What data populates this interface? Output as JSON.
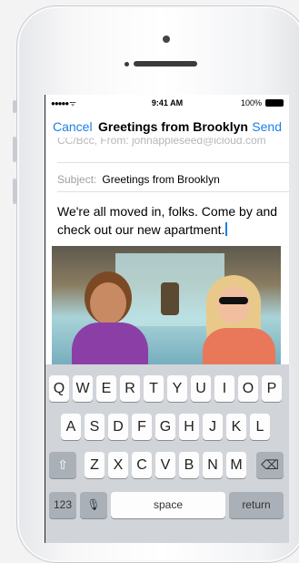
{
  "status_bar": {
    "signal": "●●●●● ᯤ",
    "time": "9:41 AM",
    "battery": "100%"
  },
  "nav": {
    "cancel": "Cancel",
    "title": "Greetings from Brooklyn",
    "send": "Send"
  },
  "compose": {
    "from_line": "CC/Bcc, From: johnappleseed@icloud.com",
    "subject_label": "Subject:",
    "subject_value": "Greetings from Brooklyn",
    "body": "We're all moved in, folks. Come by and check out our new apartment."
  },
  "keyboard": {
    "row1": [
      "Q",
      "W",
      "E",
      "R",
      "T",
      "Y",
      "U",
      "I",
      "O",
      "P"
    ],
    "row2": [
      "A",
      "S",
      "D",
      "F",
      "G",
      "H",
      "J",
      "K",
      "L"
    ],
    "row3": [
      "Z",
      "X",
      "C",
      "V",
      "B",
      "N",
      "M"
    ],
    "shift": "⇧",
    "delete": "⌫",
    "numbers": "123",
    "mic": "🎙",
    "space": "space",
    "return": "return"
  },
  "icons": {
    "shift": "shift-icon",
    "delete": "delete-icon",
    "mic": "microphone-icon",
    "battery": "battery-icon",
    "wifi": "wifi-icon"
  }
}
